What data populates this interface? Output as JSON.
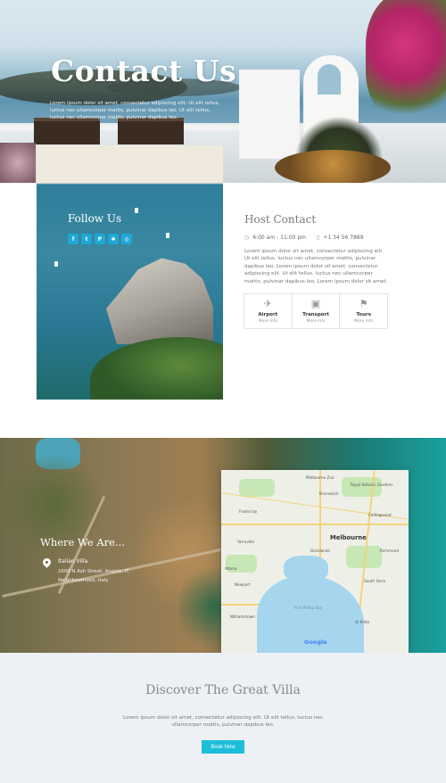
{
  "hero": {
    "title": "Contact Us",
    "text": "Lorem ipsum dolor sit amet, consectetur adipiscing elit. Ut elit tellus, luctus nec ullamcorper mattis, pulvinar dapibus leo. Ut elit tellus, luctus nec ullamcorper mattis, pulvinar dapibus leo."
  },
  "follow": {
    "title": "Follow Us",
    "icons": [
      "facebook-icon",
      "twitter-icon",
      "pinterest-icon",
      "yelp-icon",
      "instagram-icon"
    ]
  },
  "host": {
    "title": "Host Contact",
    "hours": "6:00 am - 11:00 pm",
    "phone": "+1 34 56 7889",
    "text": "Lorem ipsum dolor sit amet, consectetur adipiscing elit. Ut elit tellus, luctus nec ullamcorper mattis, pulvinar dapibus leo. Lorem ipsum dolor sit amet, consectetur adipiscing elit. Ut elit tellus, luctus nec ullamcorper mattis, pulvinar dapibus leo. Lorem ipsum dolor sit amet.",
    "features": [
      {
        "icon": "plane-icon",
        "label": "Airport",
        "more": "More Info"
      },
      {
        "icon": "bus-icon",
        "label": "Transport",
        "more": "More Info"
      },
      {
        "icon": "flag-icon",
        "label": "Tours",
        "more": "More Info"
      }
    ]
  },
  "location": {
    "title": "Where We Are...",
    "name": "Italian Villa",
    "street": "1600 N Ash Street, Angola, IT",
    "extra": "Neighbourhood, Italy"
  },
  "map": {
    "city": "Melbourne",
    "labels": [
      "Melbourne Zoo",
      "Royal Botanic Gardens",
      "Richmond",
      "Footscray",
      "Docklands",
      "South Yarra",
      "Williamstown",
      "Port Phillip Bay",
      "St Kilda",
      "Collingwood",
      "Newport",
      "Altona",
      "Yarraville",
      "Brunswick"
    ],
    "attribution": "Google"
  },
  "discover": {
    "title": "Discover The Great Villa",
    "text": "Lorem ipsum dolor sit amet, consectetur adipiscing elit. Ut elit tellus, luctus nec ullamcorper mattis, pulvinar dapibus leo.",
    "button": "Book Now"
  },
  "colors": {
    "accent": "#1cbfd9",
    "social": "#1fa8d6",
    "discover_bg": "#edf0f4"
  }
}
